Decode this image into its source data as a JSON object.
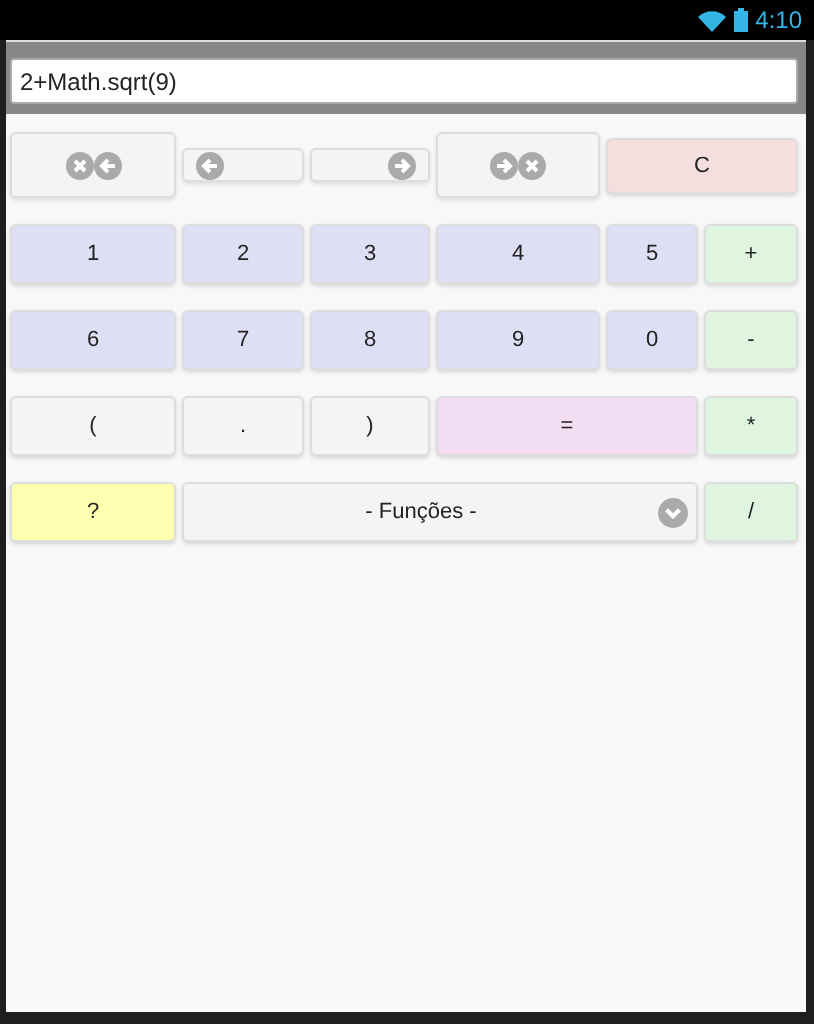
{
  "status_bar": {
    "time": "4:10"
  },
  "expression_field": {
    "value": "2+Math.sqrt(9)"
  },
  "clear_key": {
    "label": "C"
  },
  "keys": [
    {
      "label": "1",
      "kind": "digit"
    },
    {
      "label": "2",
      "kind": "digit"
    },
    {
      "label": "3",
      "kind": "digit"
    },
    {
      "label": "4",
      "kind": "digit"
    },
    {
      "label": "5",
      "kind": "digit"
    },
    {
      "label": "+",
      "kind": "operator"
    },
    {
      "label": "6",
      "kind": "digit"
    },
    {
      "label": "7",
      "kind": "digit"
    },
    {
      "label": "8",
      "kind": "digit"
    },
    {
      "label": "9",
      "kind": "digit"
    },
    {
      "label": "0",
      "kind": "digit"
    },
    {
      "label": "-",
      "kind": "operator"
    },
    {
      "label": "(",
      "kind": "plain"
    },
    {
      "label": ".",
      "kind": "plain"
    },
    {
      "label": ")",
      "kind": "plain"
    },
    {
      "label": "=",
      "kind": "equals"
    },
    {
      "label": "*",
      "kind": "operator"
    }
  ],
  "last_row": {
    "help": {
      "label": "?"
    },
    "functions_select": {
      "value": "- Funções -"
    },
    "divide": {
      "label": "/"
    }
  }
}
